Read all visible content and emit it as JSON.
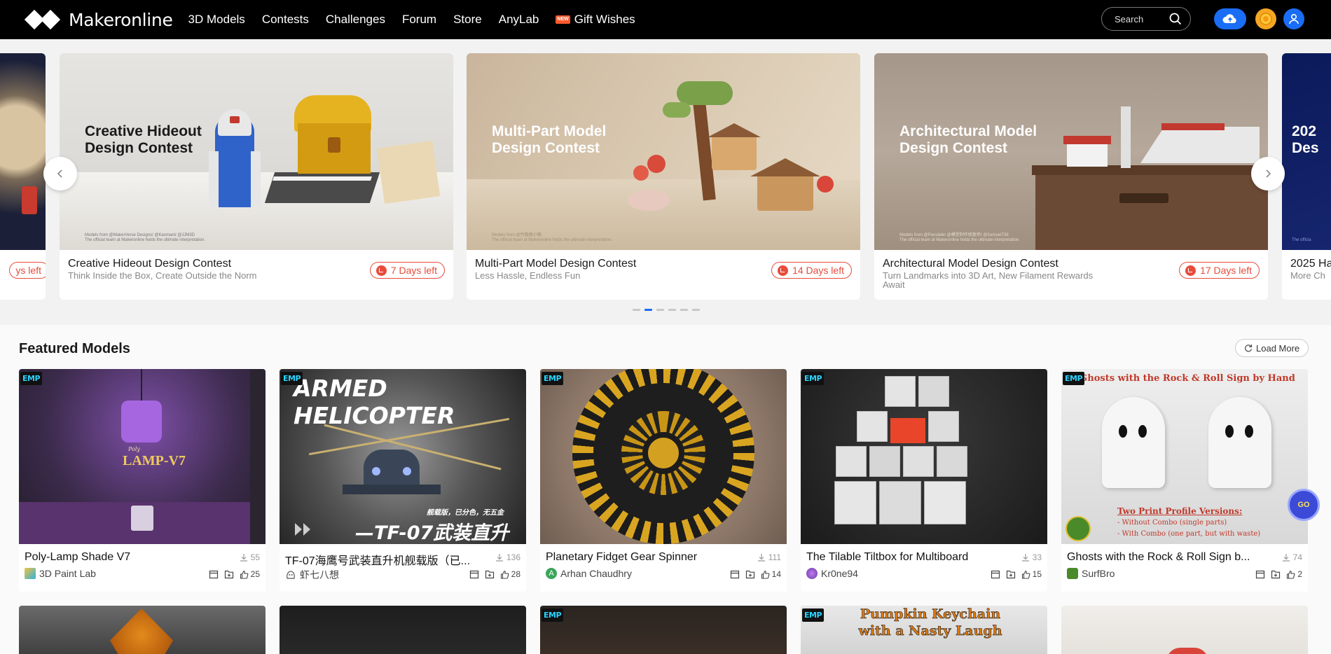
{
  "nav": {
    "logo": "Makeronline",
    "links": [
      "3D Models",
      "Contests",
      "Challenges",
      "Forum",
      "Store",
      "AnyLab"
    ],
    "gift": {
      "badge": "NEW",
      "label": "Gift Wishes"
    },
    "search_placeholder": "Search"
  },
  "carousel": {
    "prev_partial_days": "ys left",
    "slides": [
      {
        "banner": "Creative Hideout\nDesign Contest",
        "name": "Creative Hideout Design Contest",
        "subtitle": "Think Inside the Box, Create Outside the Norm",
        "days": "7 Days left",
        "fine": "Models from @MakerVerse Designs/ @Kasmani/ @JJM3D\nThe official team at Makeronline holds the ultimate interpretation."
      },
      {
        "banner": "Multi-Part Model\nDesign Contest",
        "name": "Multi-Part Model Design Contest",
        "subtitle": "Less Hassle, Endless Fun",
        "days": "14 Days left",
        "fine": "Models from @竹隐阁小榭\nThe official team at Makeronline holds the ultimate interpretation."
      },
      {
        "banner": "Architectural Model\nDesign Contest",
        "name": "Architectural Model Design Contest",
        "subtitle": "Turn Landmarks into 3D Art, New Filament Rewards Await",
        "days": "17 Days left",
        "fine": "Models from @Parcdele/ @模型制作修复师/ @Samuel738\nThe official team at Makeronline holds the ultimate interpretation."
      }
    ],
    "next_partial": {
      "banner": "202\nDes",
      "name": "2025 Ha",
      "subtitle": "More Ch",
      "fine": "The officia"
    },
    "active_dot": 1,
    "dot_count": 6
  },
  "featured": {
    "title": "Featured Models",
    "load_more": "Load More",
    "cards": [
      {
        "title": "Poly-Lamp Shade V7",
        "downloads": "55",
        "author": "3D Paint Lab",
        "likes": "25",
        "badge": "EMP",
        "img_text": "LAMP-V7",
        "img_text_small": "Poly"
      },
      {
        "title": "TF-07海鹰号武装直升机舰载版（已...",
        "downloads": "136",
        "author": "虾七八想",
        "likes": "28",
        "badge": "EMP",
        "img_text": "ARMED HELICOPTER",
        "img_text_small": "—TF-07武装直升机",
        "img_text_tiny": "舰载版，已分色，无五金"
      },
      {
        "title": "Planetary Fidget Gear Spinner",
        "downloads": "111",
        "author": "Arhan Chaudhry",
        "likes": "14",
        "badge": "EMP",
        "avatar_letter": "A"
      },
      {
        "title": "The Tilable Tiltbox for Multiboard",
        "downloads": "33",
        "author": "Kr0ne94",
        "likes": "15",
        "badge": "EMP"
      },
      {
        "title": "Ghosts with the Rock & Roll Sign b...",
        "downloads": "74",
        "author": "SurfBro",
        "likes": "2",
        "badge": "EMP",
        "img_text": "Ghosts with the Rock & Roll Sign by Hand",
        "img_text_small": "Two Print Profile Versions:",
        "img_line1": "- Without Combo (single parts)",
        "img_line2": "- With Combo (one part, but with waste)"
      }
    ],
    "row2": [
      {
        "badge": ""
      },
      {
        "badge": ""
      },
      {
        "badge": "EMP"
      },
      {
        "badge": "EMP",
        "img_text": "Pumpkin Keychain\nwith a Nasty Laugh"
      },
      {
        "badge": ""
      }
    ]
  },
  "float_help": "GO"
}
